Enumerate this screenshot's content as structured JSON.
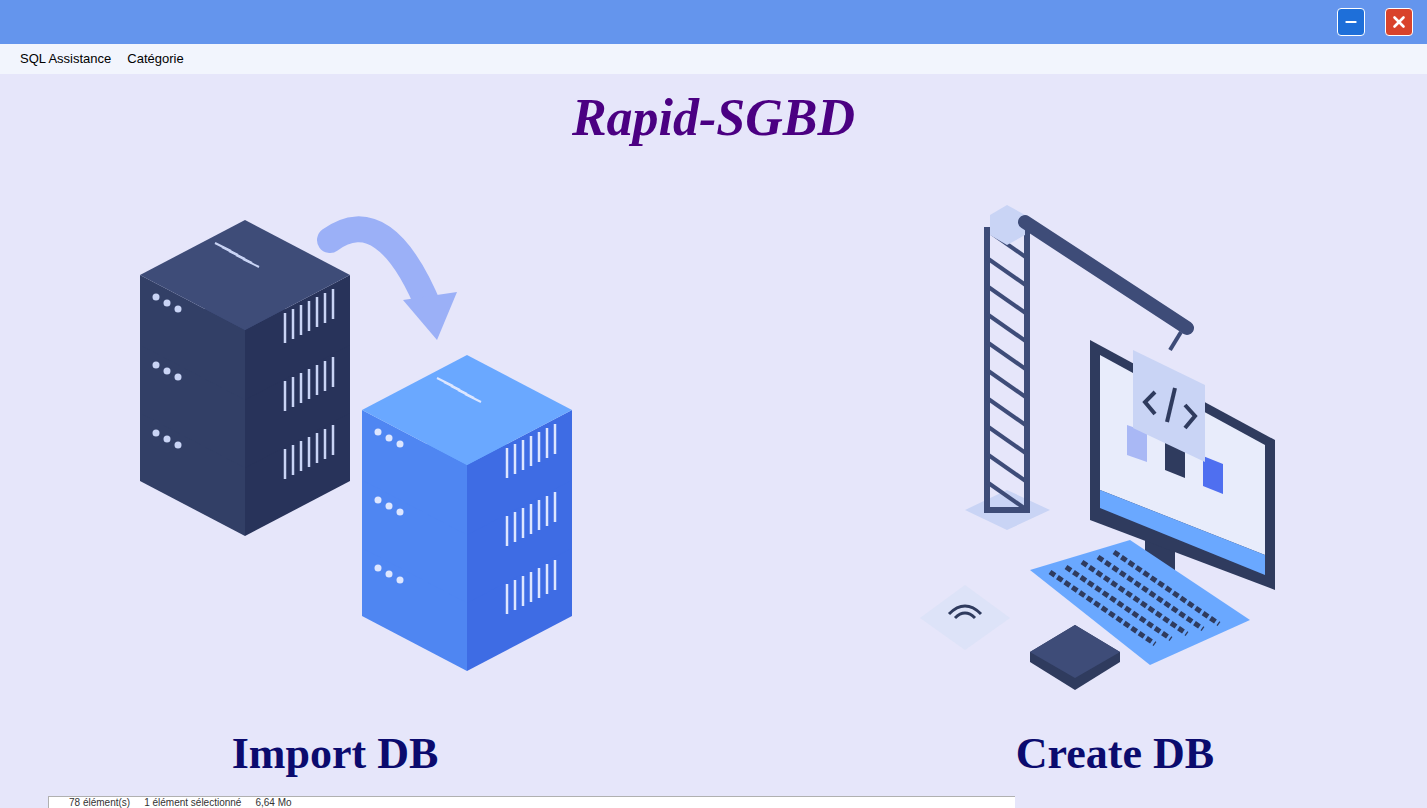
{
  "app_title": "Rapid-SGBD",
  "menu": [
    {
      "label": "SQL Assistance"
    },
    {
      "label": "Catégorie"
    }
  ],
  "actions": [
    {
      "label": "Import DB",
      "kind": "import"
    },
    {
      "label": "Create DB",
      "kind": "create"
    }
  ],
  "status_bar": {
    "items": [
      "78 élément(s)",
      "1 élément sélectionné",
      "6,64 Mo"
    ]
  }
}
